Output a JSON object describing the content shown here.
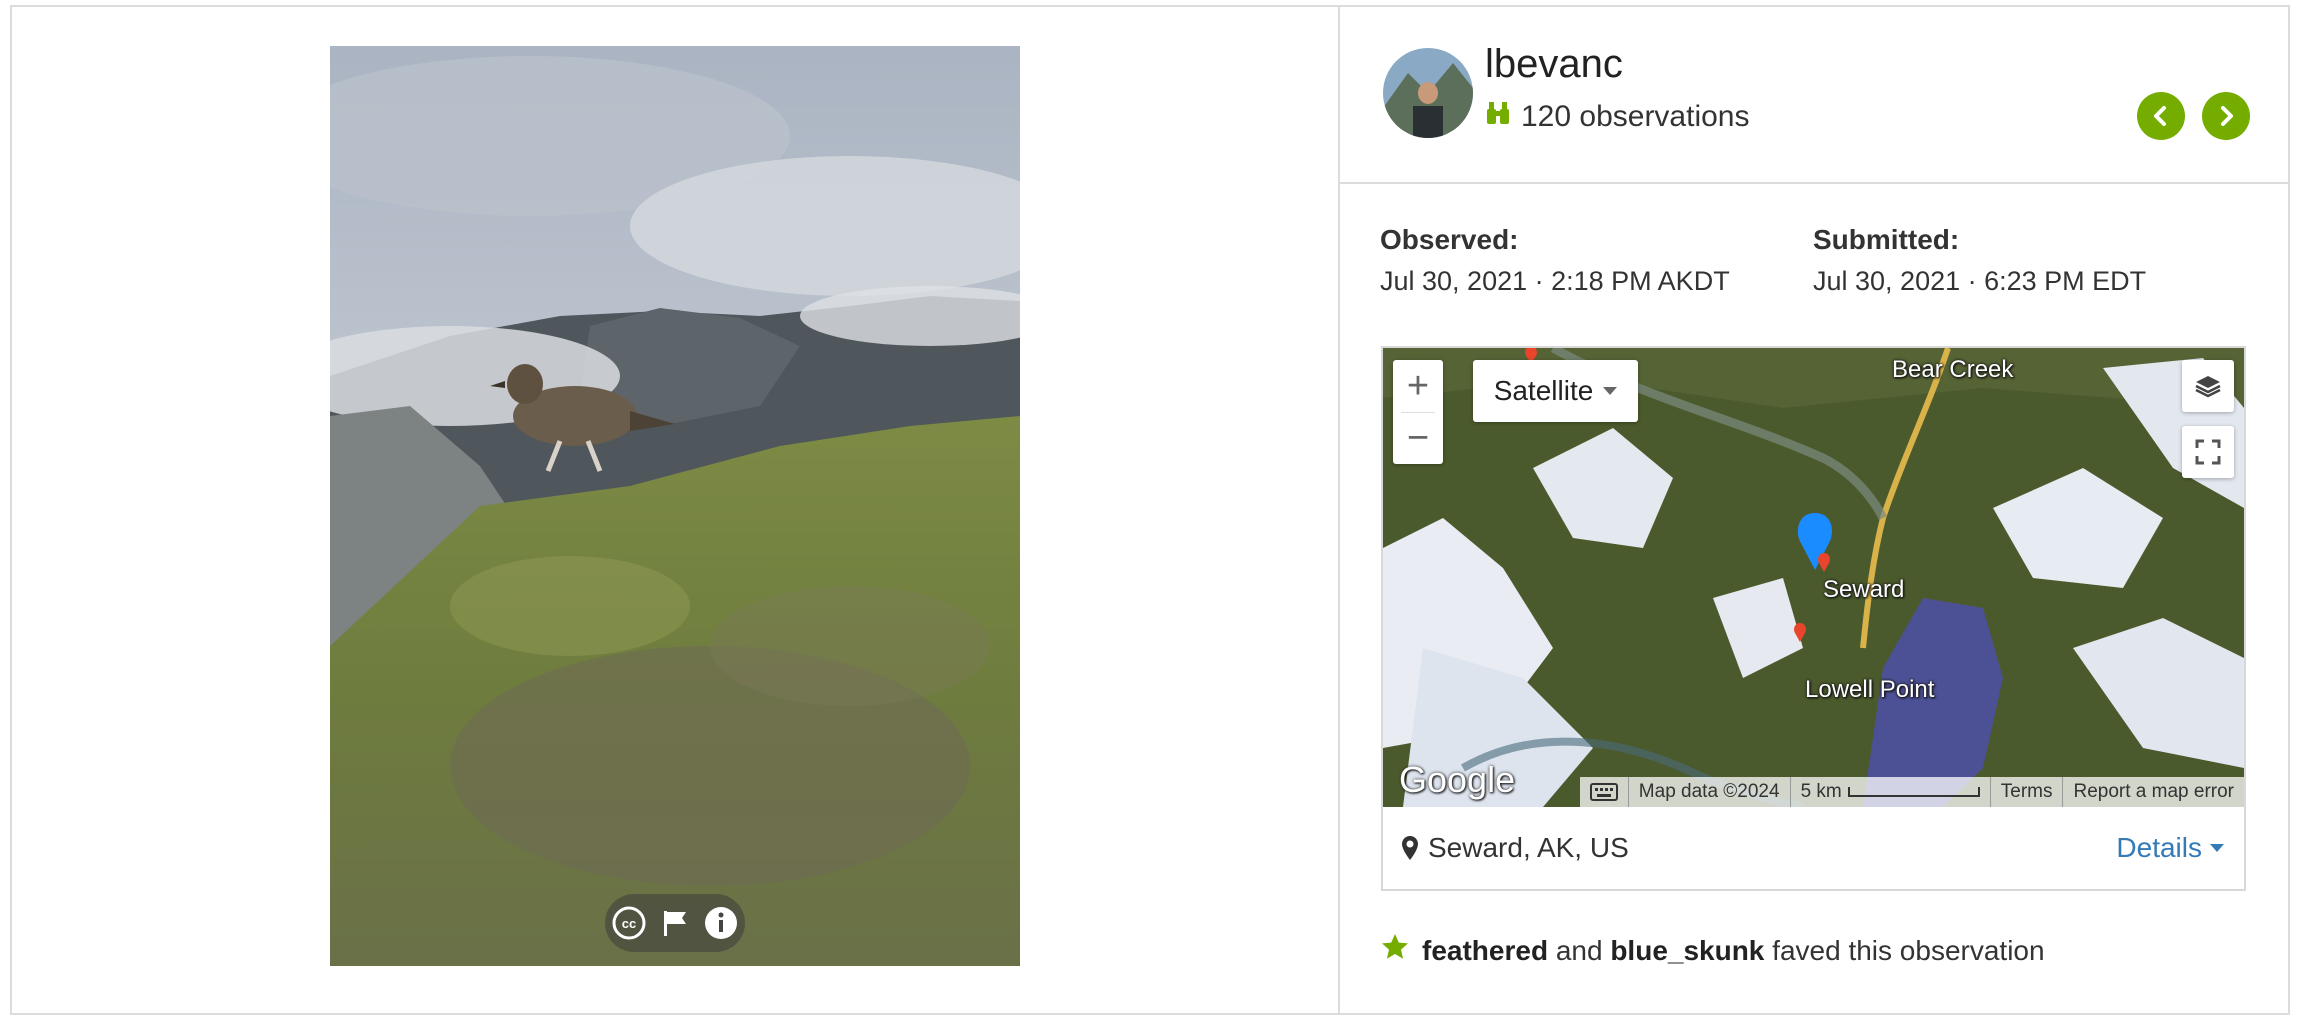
{
  "user": {
    "name": "lbevanc",
    "observations": "120 observations"
  },
  "photo": {
    "controls": [
      "cc-license-icon",
      "flag-icon",
      "info-icon"
    ]
  },
  "dates": {
    "observed_label": "Observed:",
    "observed_value": "Jul 30, 2021 · 2:18 PM AKDT",
    "submitted_label": "Submitted:",
    "submitted_value": "Jul 30, 2021 · 6:23 PM EDT"
  },
  "map": {
    "type_label": "Satellite",
    "zoom_in": "+",
    "zoom_out": "−",
    "labels": {
      "bear_creek": "Bear Creek",
      "seward": "Seward",
      "lowell_point": "Lowell Point"
    },
    "logo": "Google",
    "attribution": {
      "data": "Map data ©2024",
      "scale": "5 km",
      "terms": "Terms",
      "report": "Report a map error"
    }
  },
  "location": {
    "text": "Seward, AK, US",
    "details_label": "Details"
  },
  "faves": {
    "user1": "feathered",
    "and": "and",
    "user2": "blue_skunk",
    "suffix": "faved this observation"
  },
  "colors": {
    "accent_green": "#74ac00",
    "link_blue": "#337ab7",
    "marker_blue": "#1a8cff",
    "marker_red": "#e8452c"
  }
}
